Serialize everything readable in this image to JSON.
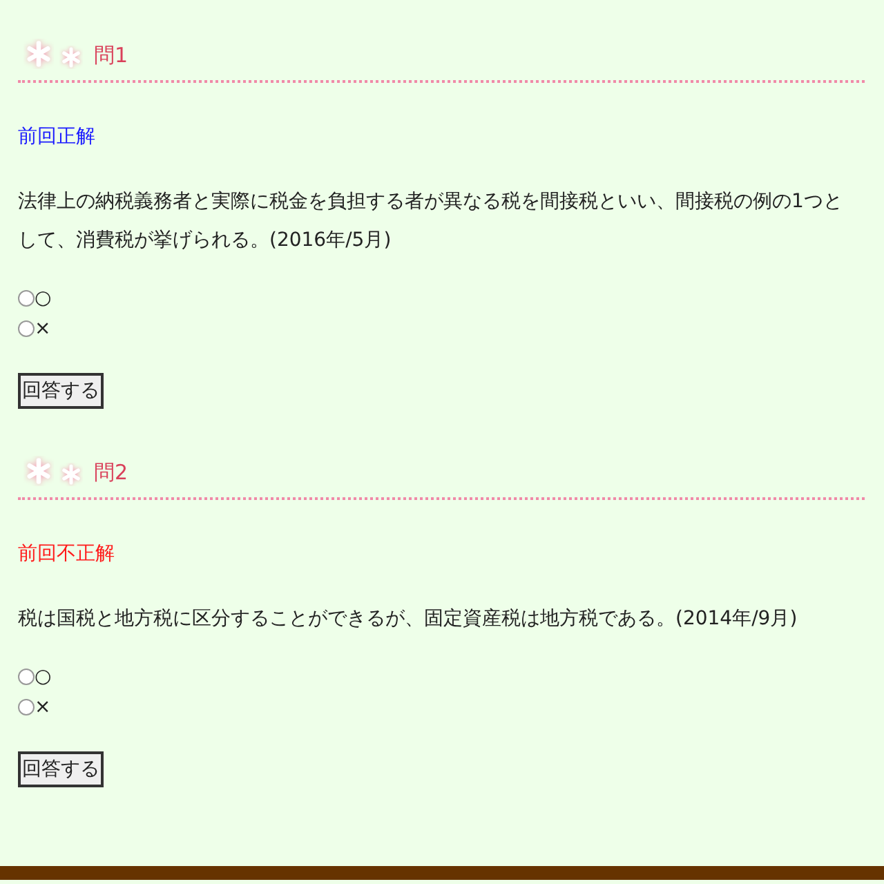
{
  "questions": [
    {
      "title": "問1",
      "result": "前回正解",
      "correct": true,
      "text": "法律上の納税義務者と実際に税金を負担する者が異なる税を間接税といい、間接税の例の1つとして、消費税が挙げられる。(2016年/5月)",
      "options": [
        {
          "label": "○",
          "selected": false
        },
        {
          "label": "×",
          "selected": false
        }
      ],
      "button": "回答する"
    },
    {
      "title": "問2",
      "result": "前回不正解",
      "correct": false,
      "text": "税は国税と地方税に区分することができるが、固定資産税は地方税である。(2014年/9月)",
      "options": [
        {
          "label": "○",
          "selected": false
        },
        {
          "label": "×",
          "selected": false
        }
      ],
      "button": "回答する"
    }
  ]
}
